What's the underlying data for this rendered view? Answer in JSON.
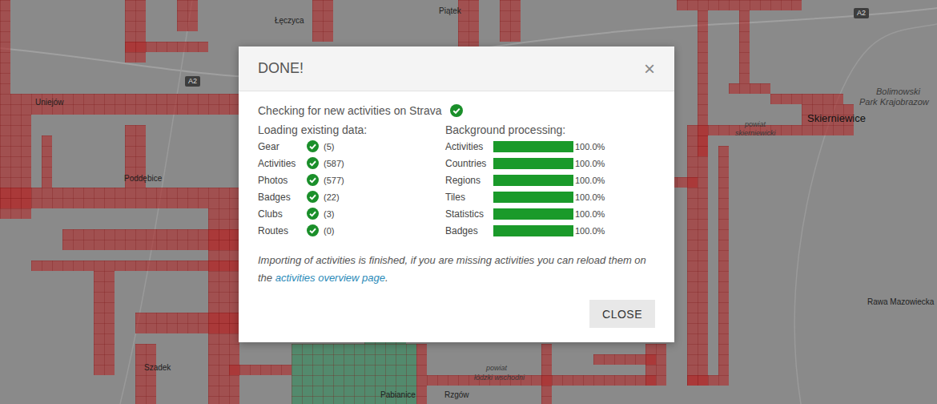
{
  "window": {
    "title": "DONE!",
    "close": "×"
  },
  "check": {
    "label": "Checking for new activities on Strava",
    "done": true
  },
  "loading": {
    "title": "Loading existing data:",
    "items": [
      {
        "label": "Gear",
        "count": "(5)",
        "done": true
      },
      {
        "label": "Activities",
        "count": "(587)",
        "done": true
      },
      {
        "label": "Photos",
        "count": "(577)",
        "done": true
      },
      {
        "label": "Badges",
        "count": "(22)",
        "done": true
      },
      {
        "label": "Clubs",
        "count": "(3)",
        "done": true
      },
      {
        "label": "Routes",
        "count": "(0)",
        "done": true
      }
    ]
  },
  "processing": {
    "title": "Background processing:",
    "items": [
      {
        "label": "Activities",
        "level": 1,
        "reading": "100.0%"
      },
      {
        "label": "Countries",
        "level": 1,
        "reading": "100.0%"
      },
      {
        "label": "Regions",
        "level": 1,
        "reading": "100.0%"
      },
      {
        "label": "Tiles",
        "level": 1,
        "reading": "100.0%"
      },
      {
        "label": "Statistics",
        "level": 1,
        "reading": "100.0%"
      },
      {
        "label": "Badges",
        "level": 1,
        "reading": "100.0%"
      }
    ]
  },
  "note": {
    "before": "Importing of activities is finished, if you are missing activities you can reload them on the ",
    "link": "activities overview page",
    "after": "."
  },
  "buttons": [
    "CLOSE"
  ],
  "map": {
    "labels": [
      {
        "text": "Łęczyca",
        "kind": "town"
      },
      {
        "text": "Piątek",
        "kind": "town"
      },
      {
        "text": "A2",
        "kind": "road"
      },
      {
        "text": "A2",
        "kind": "road"
      },
      {
        "text": "Uniejów",
        "kind": "town"
      },
      {
        "text": "Poddębice",
        "kind": "town"
      },
      {
        "text": "Bolimowski",
        "kind": "park"
      },
      {
        "text": "Park Krajobrazow",
        "kind": "park"
      },
      {
        "text": "Skierniewice",
        "kind": "city"
      },
      {
        "text": "powiat",
        "kind": "area"
      },
      {
        "text": "skierniewicki",
        "kind": "area"
      },
      {
        "text": "Rawa Mazowiecka",
        "kind": "town"
      },
      {
        "text": "Szadek",
        "kind": "town"
      },
      {
        "text": "Pabianice",
        "kind": "town"
      },
      {
        "text": "Rzgów",
        "kind": "town"
      },
      {
        "text": "powiat",
        "kind": "area"
      },
      {
        "text": "łódzki wschodni",
        "kind": "area"
      }
    ],
    "tiles": [
      {
        "kind": "visited",
        "color": "#b02a2a",
        "rects": [
          [
            0,
            0,
            1,
            9
          ],
          [
            0,
            9,
            23,
            2
          ],
          [
            12,
            0,
            2,
            6
          ],
          [
            17,
            0,
            2,
            3
          ],
          [
            30,
            0,
            2,
            4
          ],
          [
            44,
            0,
            2,
            5
          ],
          [
            48,
            0,
            2,
            4
          ],
          [
            12,
            4,
            8,
            1
          ],
          [
            65,
            0,
            12,
            1
          ],
          [
            67,
            1,
            1,
            14
          ],
          [
            71,
            1,
            1,
            7
          ],
          [
            70,
            8,
            4,
            1
          ],
          [
            74,
            9,
            7,
            1
          ],
          [
            77,
            10,
            5,
            2
          ],
          [
            66,
            12,
            16,
            1
          ],
          [
            66,
            13,
            2,
            24
          ],
          [
            69,
            14,
            1,
            22
          ],
          [
            66,
            36,
            4,
            1
          ],
          [
            64,
            17,
            3,
            1
          ],
          [
            0,
            11,
            3,
            10
          ],
          [
            0,
            18,
            24,
            2
          ],
          [
            4,
            13,
            1,
            5
          ],
          [
            12,
            12,
            2,
            6
          ],
          [
            6,
            22,
            18,
            2
          ],
          [
            3,
            25,
            20,
            1
          ],
          [
            9,
            26,
            2,
            10
          ],
          [
            13,
            30,
            10,
            2
          ],
          [
            13,
            33,
            2,
            6
          ],
          [
            20,
            20,
            3,
            19
          ],
          [
            22,
            35,
            6,
            1
          ],
          [
            40,
            33,
            1,
            6
          ],
          [
            41,
            36,
            22,
            1
          ],
          [
            52,
            33,
            1,
            6
          ],
          [
            57,
            34,
            6,
            1
          ],
          [
            62,
            33,
            2,
            4
          ]
        ]
      },
      {
        "kind": "square",
        "color": "#2f8a5a",
        "rects": [
          [
            28,
            33,
            12,
            6
          ],
          [
            35,
            31,
            4,
            2
          ]
        ]
      }
    ]
  }
}
